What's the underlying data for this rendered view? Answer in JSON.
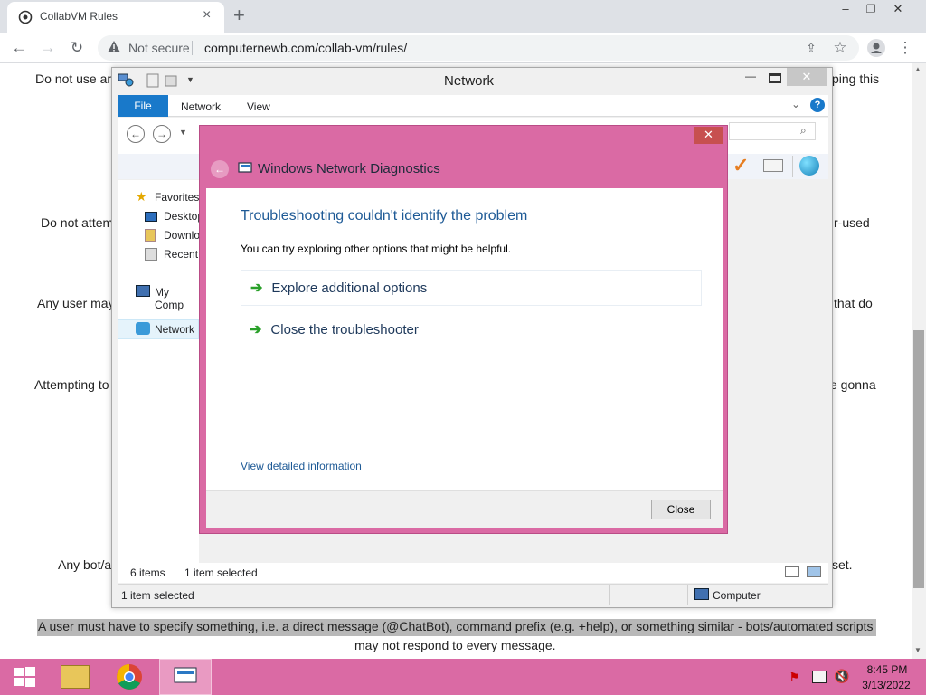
{
  "browser": {
    "tab_title": "CollabVM Rules",
    "tab_close": "×",
    "new_tab": "+",
    "not_secure": "Not secure",
    "url": "computernewb.com/collab-vm/rules/",
    "win_min": "–",
    "win_max": "❐",
    "win_close": "✕"
  },
  "page": {
    "line1_left": "Do not use ar",
    "line1_right": "ping this",
    "line2_left": "Do not attem",
    "line2_right": "r-used",
    "line3_left": "Any user may",
    "line3_right": "that do",
    "line4_left": "Attempting to",
    "line4_right": "e gonna",
    "line5_left": "Any bot/a",
    "line5_right": "set.",
    "highlight_line": "A user must have to specify something, i.e. a direct message (@ChatBot), command prefix (e.g. +help), or something similar - bots/automated scripts",
    "last_line": "may not respond to every message."
  },
  "explorer": {
    "title": "Network",
    "ribbon": {
      "file": "File",
      "network": "Network",
      "view": "View"
    },
    "nav": [
      {
        "label": "Favorites"
      },
      {
        "label": "Desktop"
      },
      {
        "label": "Downlo"
      },
      {
        "label": "Recent"
      },
      {
        "label": "My Comp"
      },
      {
        "label": "Network"
      }
    ],
    "status_items": "6 items",
    "status_selected": "1 item selected",
    "status_bar_left": "1 item selected",
    "status_bar_right": "Computer"
  },
  "diagnostics": {
    "title": "Windows Network Diagnostics",
    "heading": "Troubleshooting couldn't identify the problem",
    "subtext": "You can try exploring other options that might be helpful.",
    "options": [
      {
        "label": "Explore additional options"
      },
      {
        "label": "Close the troubleshooter"
      }
    ],
    "detail_link": "View detailed information",
    "close_button": "Close",
    "title_close": "✕"
  },
  "taskbar": {
    "time": "8:45 PM",
    "date": "3/13/2022"
  },
  "colors": {
    "accent": "#da6aa4",
    "ribbon_file": "#1979ca",
    "heading": "#1e5a96"
  }
}
